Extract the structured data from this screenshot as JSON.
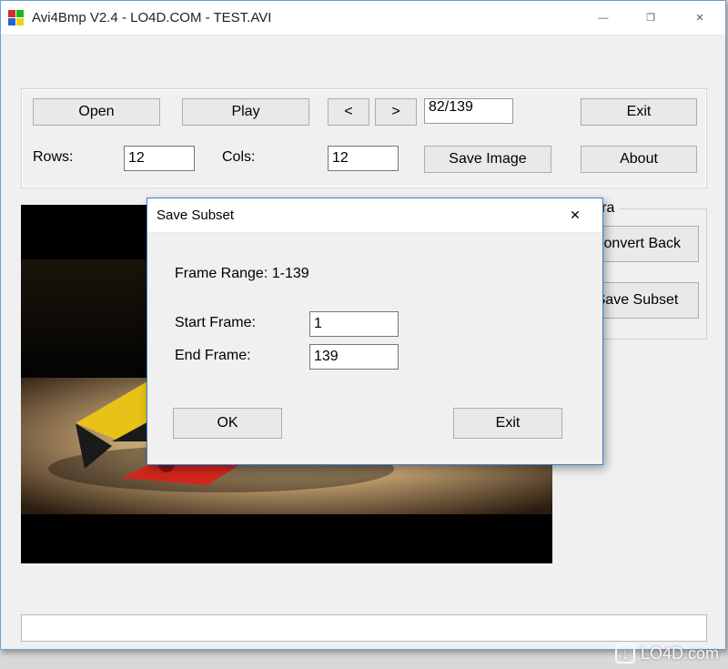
{
  "window": {
    "title": "Avi4Bmp V2.4 - LO4D.COM - TEST.AVI",
    "minimize": "—",
    "maximize": "❐",
    "close": "✕"
  },
  "toolbar": {
    "open": "Open",
    "play": "Play",
    "prev": "<",
    "next": ">",
    "frame_display": "82/139",
    "exit": "Exit",
    "rows_label": "Rows:",
    "rows_value": "12",
    "cols_label": "Cols:",
    "cols_value": "12",
    "save_image": "Save Image",
    "about": "About"
  },
  "extra": {
    "legend": "Extra",
    "convert_back": "Convert Back",
    "save_subset": "Save Subset"
  },
  "dialog": {
    "title": "Save Subset",
    "close": "✕",
    "range_label": "Frame Range:  1-139",
    "start_label": "Start Frame:",
    "start_value": "1",
    "end_label": "End Frame:",
    "end_value": "139",
    "ok": "OK",
    "exit": "Exit"
  },
  "watermark": {
    "icon": "↓",
    "text": "LO4D.com"
  }
}
